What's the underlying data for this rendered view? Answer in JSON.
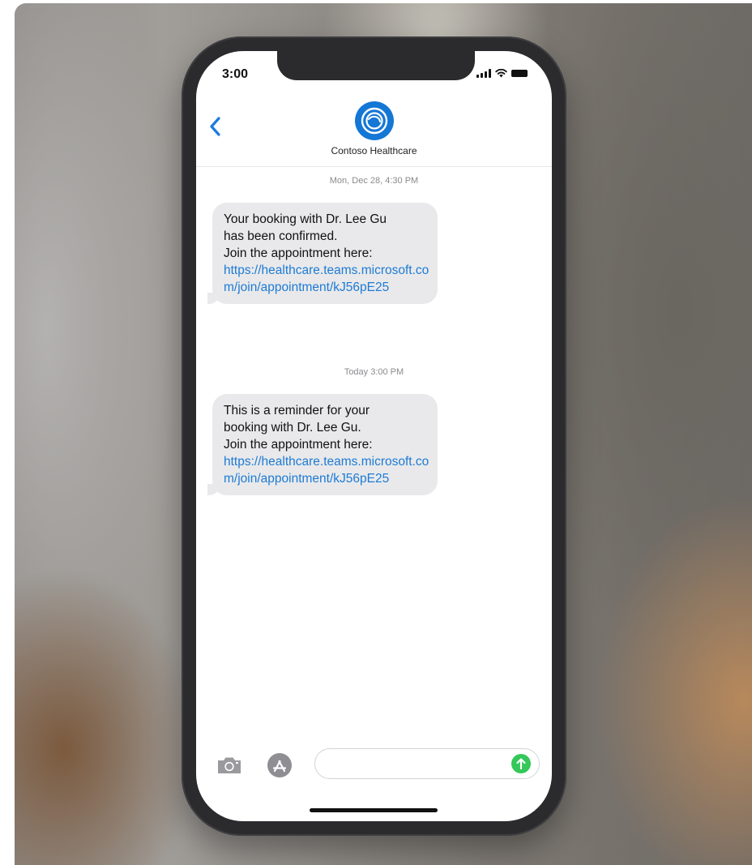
{
  "status_bar": {
    "time": "3:00"
  },
  "contact": {
    "name": "Contoso Healthcare",
    "avatar_icon": "contoso-logo-icon",
    "avatar_color": "#1477d6"
  },
  "conversation": {
    "messages": [
      {
        "timestamp": "Mon, Dec 28, 4:30 PM",
        "lines": [
          "Your booking with Dr. Lee Gu",
          "has been confirmed.",
          "Join the appointment here:"
        ],
        "link": "https://healthcare.teams.microsoft.com/join/appointment/kJ56pE25"
      },
      {
        "timestamp": "Today 3:00 PM",
        "lines": [
          "This is a reminder for your",
          "booking with Dr. Lee Gu.",
          "Join the appointment here:"
        ],
        "link": "https://healthcare.teams.microsoft.com/join/appointment/kJ56pE25"
      }
    ]
  },
  "input_bar": {
    "message_value": "",
    "send_color": "#34c759",
    "camera_icon": "camera-icon",
    "appstore_icon": "app-store-icon"
  },
  "colors": {
    "link": "#1d7bd4",
    "bubble": "#e9e9eb",
    "accent": "#1477d6"
  }
}
